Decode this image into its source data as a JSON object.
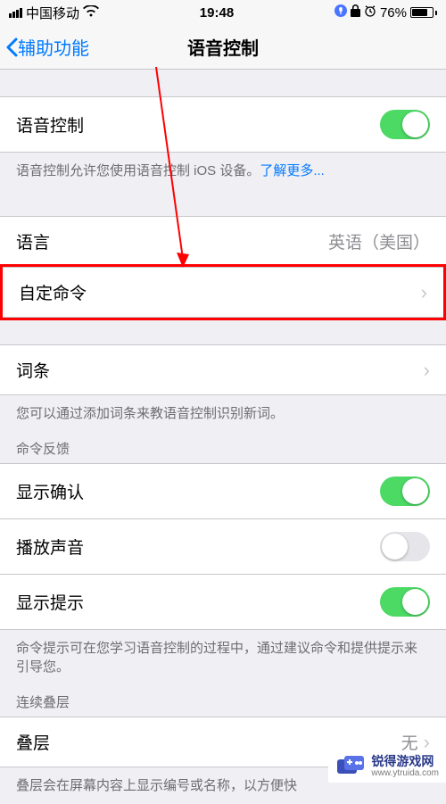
{
  "status": {
    "carrier": "中国移动",
    "time": "19:48",
    "battery_pct": "76%"
  },
  "nav": {
    "back": "辅助功能",
    "title": "语音控制"
  },
  "voice_control": {
    "label": "语音控制",
    "desc_prefix": "语音控制允许您使用语音控制 iOS 设备。",
    "learn_more": "了解更多..."
  },
  "language": {
    "label": "语言",
    "value": "英语（美国）"
  },
  "custom_commands": {
    "label": "自定命令"
  },
  "vocabulary": {
    "label": "词条",
    "desc": "您可以通过添加词条来教语音控制识别新词。"
  },
  "feedback_header": "命令反馈",
  "show_confirm": {
    "label": "显示确认"
  },
  "play_sound": {
    "label": "播放声音"
  },
  "show_hints": {
    "label": "显示提示",
    "desc": "命令提示可在您学习语音控制的过程中，通过建议命令和提供提示来引导您。"
  },
  "overlay_header": "连续叠层",
  "overlay": {
    "label": "叠层",
    "value": "无"
  },
  "overlay_desc": "叠层会在屏幕内容上显示编号或名称，以方便快",
  "watermark": {
    "line1": "锐得游戏网",
    "line2": "www.ytruida.com"
  }
}
